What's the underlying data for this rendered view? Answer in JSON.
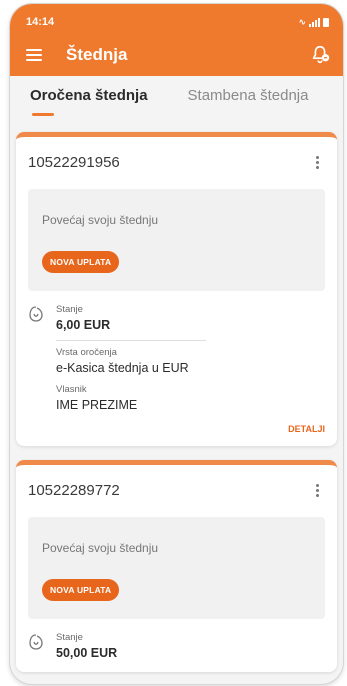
{
  "status_bar": {
    "time": "14:14",
    "signal_text": "∿",
    "battery_icon": "battery-icon"
  },
  "app_bar": {
    "title": "Štednja",
    "menu_icon": "menu-icon",
    "bell_icon": "bell-icon"
  },
  "tabs": [
    {
      "label": "Oročena štednja",
      "active": true
    },
    {
      "label": "Stambena štednja",
      "active": false
    }
  ],
  "accounts": [
    {
      "number": "10522291956",
      "promo_text": "Povećaj svoju štednju",
      "promo_button": "NOVA UPLATA",
      "balance_label": "Stanje",
      "balance_value": "6,00 EUR",
      "type_label": "Vrsta oročenja",
      "type_value": "e-Kasica štednja u EUR",
      "owner_label": "Vlasnik",
      "owner_value": "IME PREZIME",
      "details_link": "DETALJI"
    },
    {
      "number": "10522289772",
      "promo_text": "Povećaj svoju štednju",
      "promo_button": "NOVA UPLATA",
      "balance_label": "Stanje",
      "balance_value": "50,00 EUR"
    }
  ],
  "colors": {
    "accent": "#ef7a2e",
    "pill": "#e8661c",
    "card_top": "#ef8a4a"
  }
}
